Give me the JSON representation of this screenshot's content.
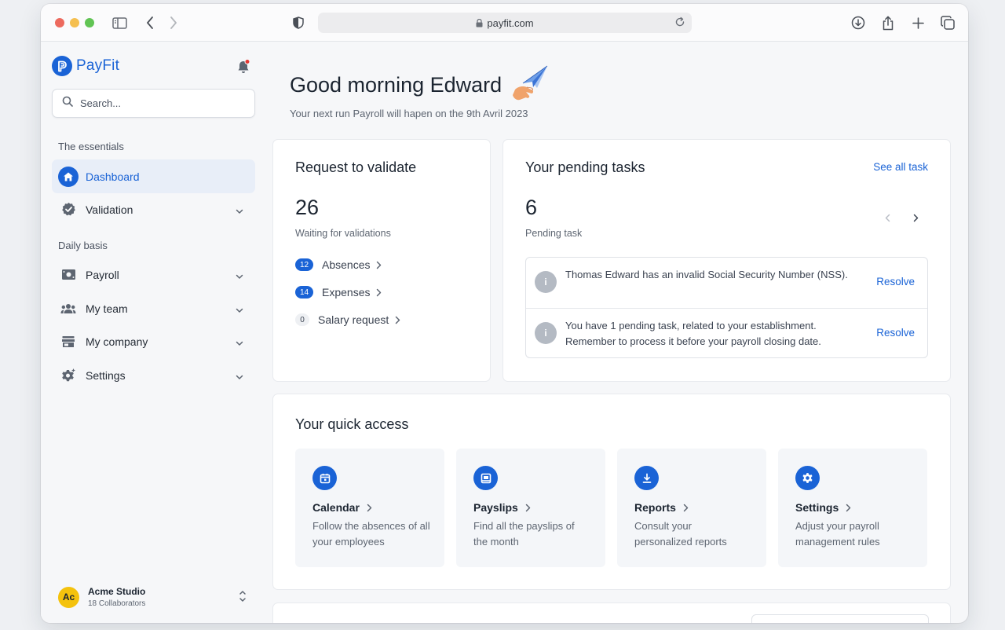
{
  "browser": {
    "url": "payfit.com",
    "colors": {
      "red": "#ed6a5e",
      "yellow": "#f5bf4f",
      "green": "#61c454"
    }
  },
  "brand": {
    "name": "PayFit",
    "color": "#1a63d6"
  },
  "sidebar": {
    "search_placeholder": "Search...",
    "section_essentials": "The essentials",
    "section_daily": "Daily basis",
    "items": [
      {
        "label": "Dashboard",
        "icon": "home-icon",
        "active": true
      },
      {
        "label": "Validation",
        "icon": "check-badge-icon"
      },
      {
        "label": "Payroll",
        "icon": "payroll-icon"
      },
      {
        "label": "My team",
        "icon": "team-icon"
      },
      {
        "label": "My company",
        "icon": "store-icon"
      },
      {
        "label": "Settings",
        "icon": "gear-icon"
      }
    ],
    "org": {
      "initials": "Ac",
      "name": "Acme Studio",
      "sub": "18 Collaborators"
    }
  },
  "header": {
    "greeting": "Good morning Edward",
    "subtitle": "Your next run Payroll will hapen on the 9th Avril 2023"
  },
  "requests": {
    "title": "Request to validate",
    "count": "26",
    "count_label": "Waiting for validations",
    "rows": [
      {
        "count": "12",
        "label": "Absences"
      },
      {
        "count": "14",
        "label": "Expenses"
      },
      {
        "count": "0",
        "label": "Salary request"
      }
    ]
  },
  "tasks": {
    "title": "Your pending tasks",
    "see_all": "See all task",
    "count": "6",
    "count_label": "Pending task",
    "items": [
      {
        "text": "Thomas Edward has an invalid Social Security Number (NSS).",
        "action": "Resolve"
      },
      {
        "text": "You have 1 pending task, related to your establishment. Remember to process it before your payroll closing date.",
        "action": "Resolve"
      }
    ]
  },
  "quick_access": {
    "title": "Your quick access",
    "tiles": [
      {
        "title": "Calendar",
        "desc": "Follow the absences of all your employees",
        "icon": "calendar-icon"
      },
      {
        "title": "Payslips",
        "desc": "Find all the payslips of the month",
        "icon": "inbox-icon"
      },
      {
        "title": "Reports",
        "desc": "Consult your personalized reports",
        "icon": "download-icon"
      },
      {
        "title": "Settings",
        "desc": "Adjust your payroll management rules",
        "icon": "gear-icon"
      }
    ]
  }
}
